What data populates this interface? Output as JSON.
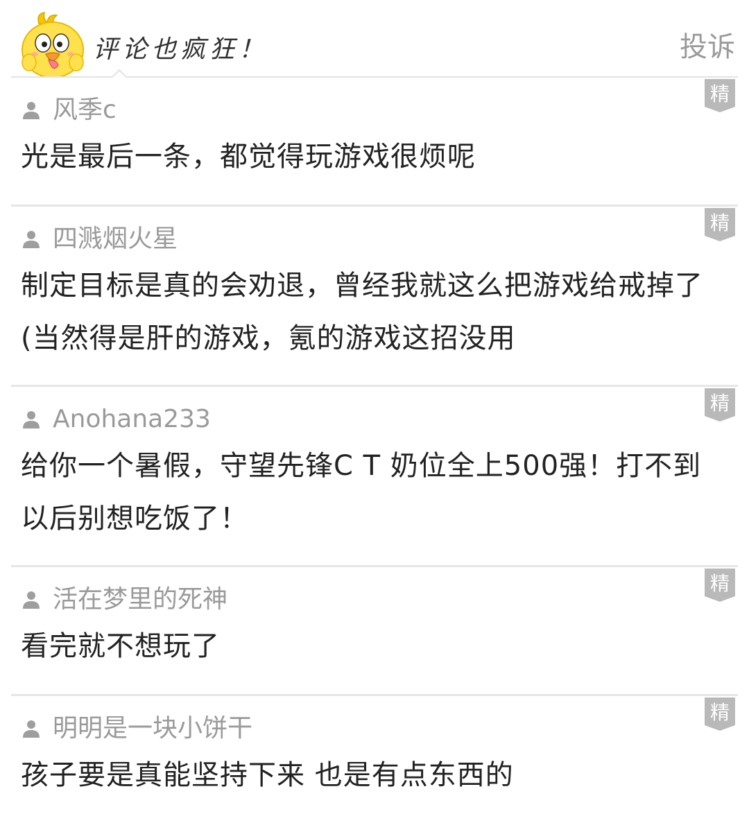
{
  "header": {
    "title": "评论也疯狂！",
    "report_label": "投诉"
  },
  "icons": {
    "mascot": "yellow-chick-mascot",
    "user": "user-silhouette-icon",
    "badge": "jing-badge-icon"
  },
  "badge_label": "精",
  "colors": {
    "text_primary": "#222222",
    "text_secondary": "#9a9a9a",
    "divider": "#e6e6e6",
    "badge": "#b9b9b9",
    "mascot_yellow": "#ffe14d"
  },
  "comments": [
    {
      "author": "风季c",
      "text": "光是最后一条，都觉得玩游戏很烦呢"
    },
    {
      "author": "四溅烟火星",
      "text": "制定目标是真的会劝退，曾经我就这么把游戏给戒掉了(当然得是肝的游戏，氪的游戏这招没用"
    },
    {
      "author": "Anohana233",
      "text": "给你一个暑假，守望先锋C T 奶位全上500强！打不到以后别想吃饭了！"
    },
    {
      "author": "活在梦里的死神",
      "text": "看完就不想玩了"
    },
    {
      "author": "明明是一块小饼干",
      "text": "孩子要是真能坚持下来 也是有点东西的"
    }
  ]
}
